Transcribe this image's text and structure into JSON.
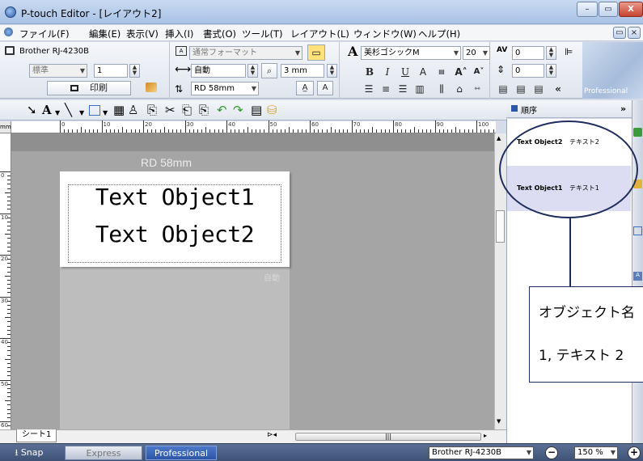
{
  "window": {
    "title": "P-touch Editor - [レイアウト2]",
    "minimize": "–",
    "restore": "▭",
    "close": "X"
  },
  "menu": {
    "items": [
      "ファイル(F)",
      "編集(E)",
      "表示(V)",
      "挿入(I)",
      "書式(O)",
      "ツール(T)",
      "レイアウト(L)",
      "ウィンドウ(W)",
      "ヘルプ(H)"
    ],
    "mdi_restore": "▭",
    "mdi_close": "×"
  },
  "ribbon": {
    "printer_name": "Brother RJ-4230B",
    "print_mode": "標準",
    "copies": "1",
    "print_label": "印刷",
    "format_select": "通常フォーマット",
    "length_mode": "自動",
    "margin": "3 mm",
    "tape": "RD 58mm",
    "font_name": "美杉ゴシックM",
    "font_size": "20",
    "char_spacing": "0",
    "line_spacing": "0",
    "professional_label": "Professional"
  },
  "right_pane": {
    "title": "順序",
    "collapse": "»",
    "items": [
      {
        "name": "Text Object2",
        "text": "テキスト2"
      },
      {
        "name": "Text Object1",
        "text": "テキスト1"
      }
    ]
  },
  "canvas": {
    "tape_label": "RD 58mm",
    "text_objects": [
      "Text Object1",
      "Text Object2"
    ],
    "auto_indicator": "自動",
    "sheet_tab": "シート1",
    "ruler_unit": "mm",
    "ruler_h_marks": [
      "0",
      "10",
      "20",
      "30",
      "40",
      "50",
      "60",
      "70",
      "80",
      "90",
      "100"
    ],
    "ruler_v_marks": [
      "0",
      "10",
      "20",
      "30",
      "40",
      "50",
      "60"
    ]
  },
  "callout": {
    "line1": "オブジェクト名",
    "line2": "1, テキスト 2"
  },
  "statusbar": {
    "snap": "Snap",
    "express": "Express",
    "professional": "Professional",
    "printer": "Brother RJ-4230B",
    "zoom": "150 %"
  }
}
